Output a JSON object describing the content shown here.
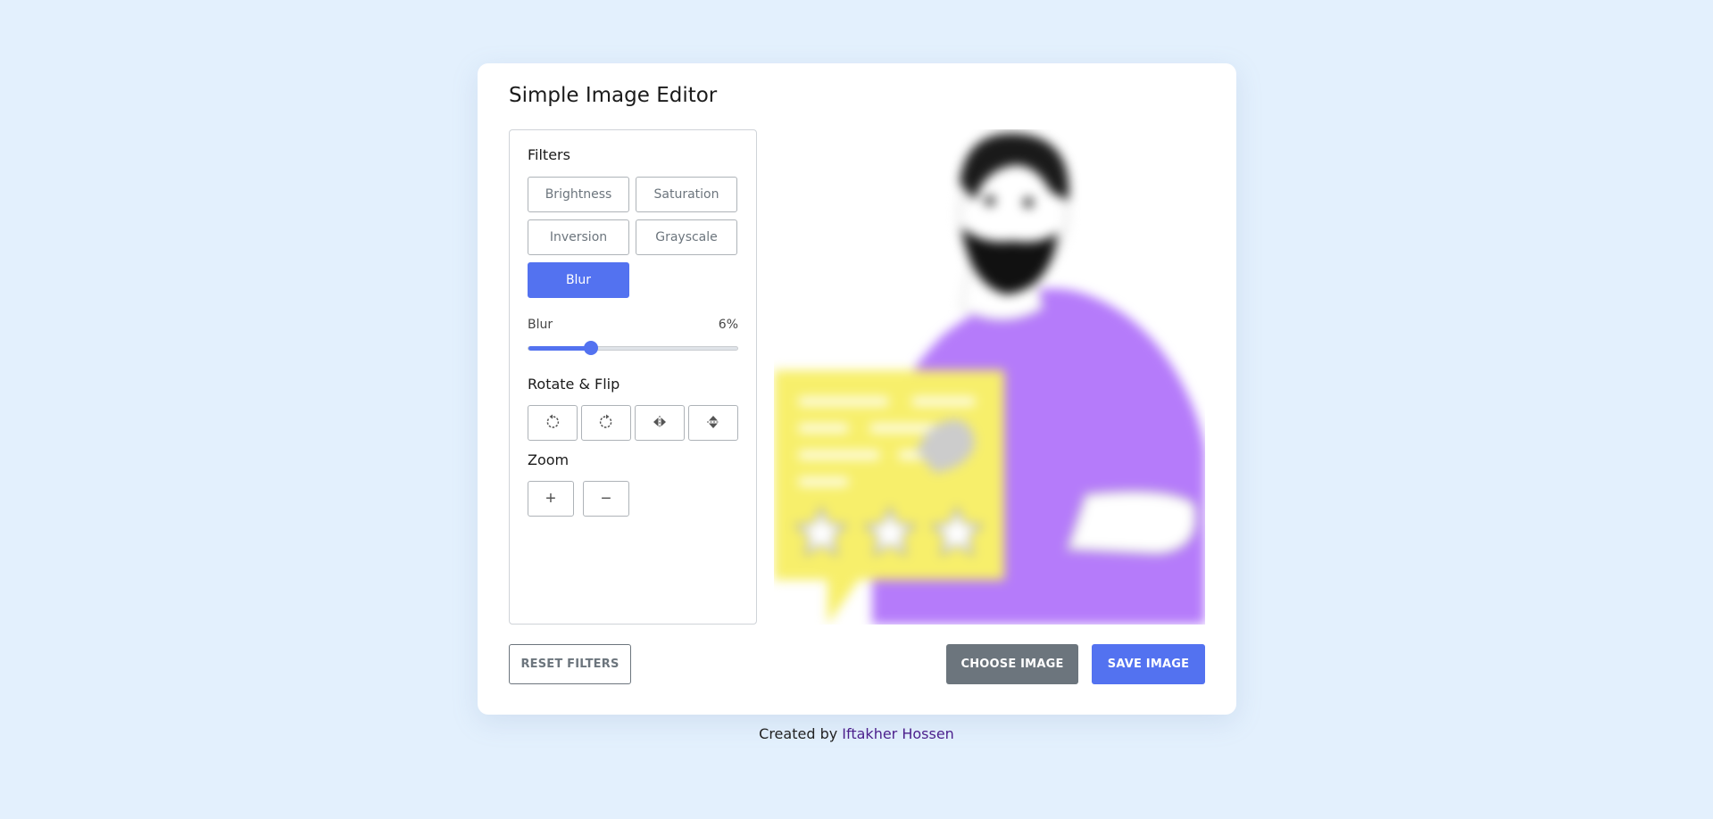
{
  "app": {
    "title": "Simple Image Editor"
  },
  "filters": {
    "heading": "Filters",
    "buttons": [
      {
        "label": "Brightness",
        "active": false
      },
      {
        "label": "Saturation",
        "active": false
      },
      {
        "label": "Inversion",
        "active": false
      },
      {
        "label": "Grayscale",
        "active": false
      },
      {
        "label": "Blur",
        "active": true
      }
    ],
    "slider": {
      "name": "Blur",
      "value_text": "6%",
      "value": 6,
      "max": 20
    }
  },
  "rotate_flip": {
    "heading": "Rotate & Flip",
    "buttons": [
      {
        "icon": "rotate-left-icon"
      },
      {
        "icon": "rotate-right-icon"
      },
      {
        "icon": "flip-horizontal-icon"
      },
      {
        "icon": "flip-vertical-icon"
      }
    ]
  },
  "zoom": {
    "heading": "Zoom",
    "in_label": "+",
    "out_label": "−"
  },
  "actions": {
    "reset_label": "RESET FILTERS",
    "choose_label": "CHOOSE IMAGE",
    "save_label": "SAVE IMAGE"
  },
  "footer": {
    "prefix": "Created by",
    "author": "Iftakher Hossen"
  },
  "colors": {
    "background": "#e3f0fd",
    "accent": "#5372f0",
    "secondary": "#6c757d",
    "author_link": "#4b1f8c"
  }
}
